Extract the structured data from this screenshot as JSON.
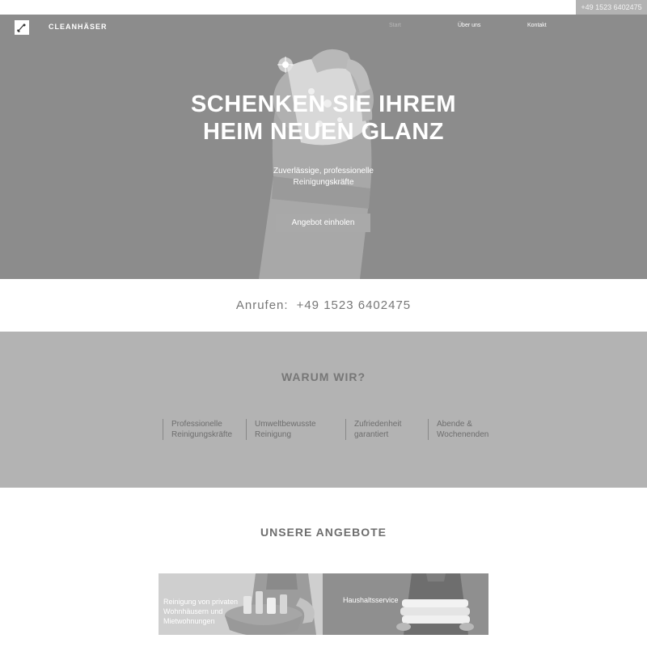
{
  "topbar": {
    "phone": "+49 1523 6402475"
  },
  "header": {
    "brand": "CLEANHÄSER",
    "logo_icon": "broom-logo-icon",
    "nav": [
      {
        "label": "Start",
        "active": true
      },
      {
        "label": "Über uns",
        "active": false
      },
      {
        "label": "Kontakt",
        "active": false
      }
    ]
  },
  "hero": {
    "title_line1": "SCHENKEN SIE IHREM",
    "title_line2": "HEIM NEUEN GLANZ",
    "subtitle_line1": "Zuverlässige, professionelle",
    "subtitle_line2": "Reinigungskräfte",
    "cta_label": "Angebot einholen",
    "image_icon": "gloved-hand-sponge-image"
  },
  "call": {
    "label": "Anrufen:",
    "phone": "+49 1523 6402475"
  },
  "why": {
    "title": "WARUM WIR?",
    "items": [
      {
        "line1": "Professionelle",
        "line2": "Reinigungskräfte"
      },
      {
        "line1": "Umweltbewusste",
        "line2": "Reinigung"
      },
      {
        "line1": "Zufriedenheit",
        "line2": "garantiert"
      },
      {
        "line1": "Abende &",
        "line2": "Wochenenden"
      }
    ]
  },
  "offers": {
    "title": "UNSERE ANGEBOTE",
    "cards": [
      {
        "line1": "Reinigung von privaten",
        "line2": "Wohnhäusern und",
        "line3": "Mietwohnungen",
        "image_icon": "cleaning-basket-image"
      },
      {
        "line1": "Haushaltsservice",
        "image_icon": "folded-towels-image"
      }
    ]
  },
  "colors": {
    "hero_bg": "#8c8c8c",
    "section_bg": "#b3b3b3",
    "cta_bg": "#a9a9a9"
  }
}
